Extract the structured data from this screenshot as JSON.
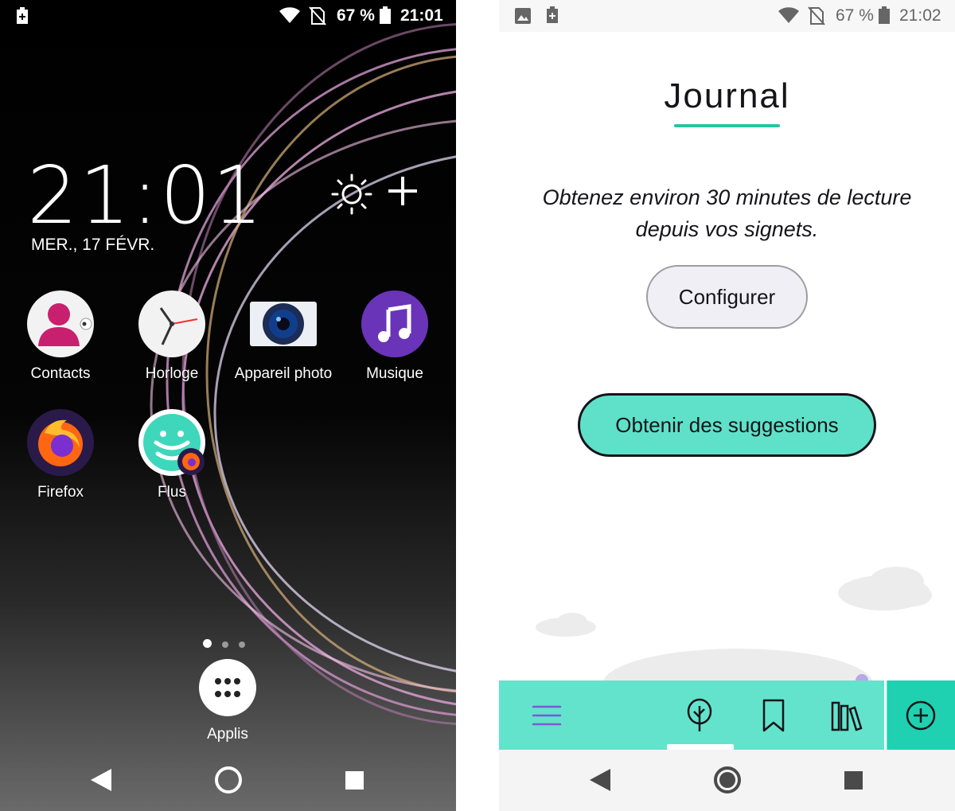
{
  "left_screen": {
    "status_bar": {
      "battery_percent": "67 %",
      "time": "21:01"
    },
    "clock": {
      "time": "21:01",
      "date": "MER., 17 FÉVR."
    },
    "apps": [
      {
        "label": "Contacts",
        "icon": "contacts-icon"
      },
      {
        "label": "Horloge",
        "icon": "clock-icon"
      },
      {
        "label": "Appareil photo",
        "icon": "camera-icon"
      },
      {
        "label": "Musique",
        "icon": "music-icon"
      },
      {
        "label": "Firefox",
        "icon": "firefox-icon"
      },
      {
        "label": "Flus",
        "icon": "flus-icon"
      }
    ],
    "app_drawer_label": "Applis"
  },
  "right_screen": {
    "status_bar": {
      "battery_percent": "67 %",
      "time": "21:02"
    },
    "title": "Journal",
    "intro": "Obtenez environ 30 minutes de lecture depuis vos signets.",
    "configure_label": "Configurer",
    "suggest_label": "Obtenir des suggestions",
    "toolbar_icons": [
      "menu-icon",
      "tree-icon",
      "bookmark-icon",
      "library-icon",
      "add-icon"
    ],
    "colors": {
      "accent": "#63e3cc",
      "accent_dark": "#1fd1b0",
      "underline": "#2ac3a2",
      "menu_icon": "#7b5bd6"
    }
  }
}
